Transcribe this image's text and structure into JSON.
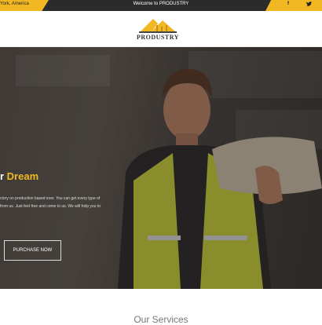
{
  "topbar": {
    "location_text": "York, America",
    "welcome_text": "Welcome to PRODUSTRY",
    "social": {
      "facebook": "f",
      "twitter": "✓"
    }
  },
  "header": {
    "logo_text": "PRODUSTRY"
  },
  "hero": {
    "title_prefix": "r ",
    "title_accent": "Dream",
    "description_line1": "ctory on production based ever. You can get every type of ",
    "description_line2": "from us. Just feel free and come to us. We will help you to",
    "cta_label": "PURCHASE NOW"
  },
  "section": {
    "title": "Our Services"
  },
  "colors": {
    "accent": "#f2b824",
    "topbar_dark": "#2b2b2b"
  }
}
